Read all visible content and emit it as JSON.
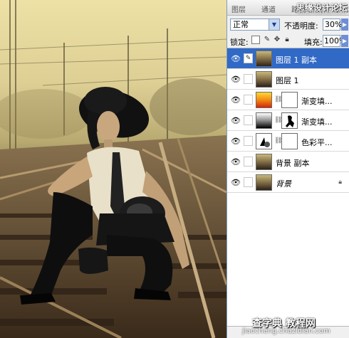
{
  "panel": {
    "tabs": [
      "图层",
      "通道",
      "路径"
    ],
    "watermark_top": "思缘设计论坛",
    "watermark_url": "www.missyuan.com",
    "blend_mode": "正常",
    "opacity_label": "不透明度:",
    "opacity_value": "30%",
    "lock_label": "锁定:",
    "fill_label": "填充:",
    "fill_value": "100%"
  },
  "layers": [
    {
      "name": "图层 1 副本",
      "selected": true,
      "thumb": "photo"
    },
    {
      "name": "图层 1",
      "selected": false,
      "thumb": "photo"
    },
    {
      "name": "渐变填...",
      "selected": false,
      "thumb": "gradient-color"
    },
    {
      "name": "渐变填...",
      "selected": false,
      "thumb": "gradient-bw"
    },
    {
      "name": "色彩平...",
      "selected": false,
      "thumb": "adjustment"
    },
    {
      "name": "背景 副本",
      "selected": false,
      "thumb": "photo"
    },
    {
      "name": "背景",
      "selected": false,
      "thumb": "photo",
      "locked": true
    }
  ],
  "watermark_bottom": "查字典 教程网",
  "watermark_bottom_url": "jiaocheng.chazidian.com",
  "colors": {
    "selection": "#3169c6",
    "panel_bg": "#f0f0f0"
  }
}
